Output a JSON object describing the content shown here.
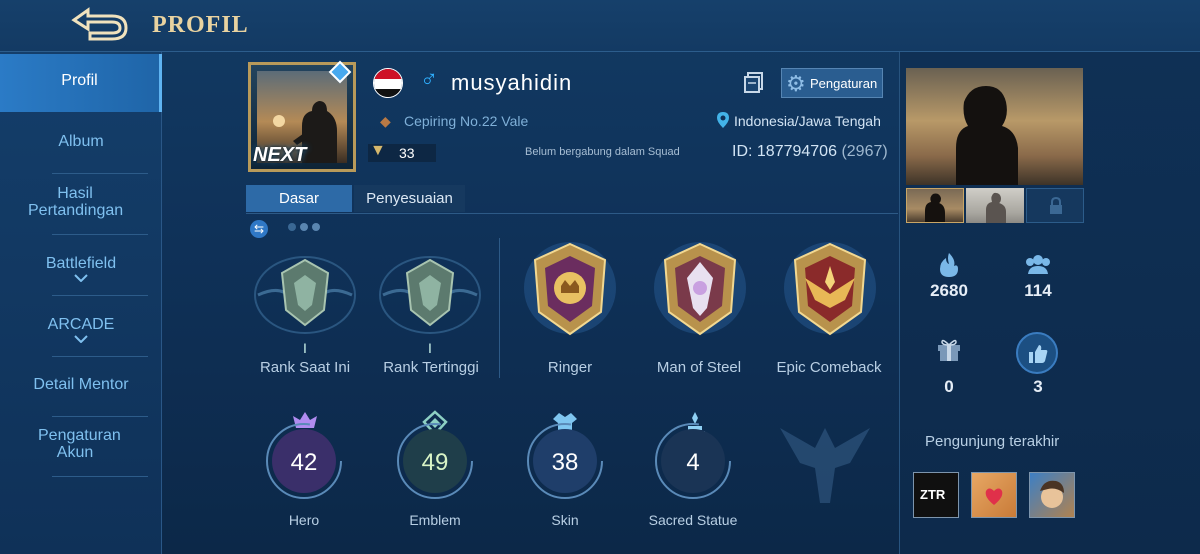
{
  "header": {
    "title": "PROFIL"
  },
  "sidebar": {
    "items": [
      {
        "label": "Profil"
      },
      {
        "label": "Album"
      },
      {
        "label": "Hasil Pertandingan"
      },
      {
        "label": "Battlefield"
      },
      {
        "label": "ARCADE"
      },
      {
        "label": "Detail Mentor"
      },
      {
        "label": "Pengaturan Akun"
      }
    ]
  },
  "profile": {
    "username": "musyahidin",
    "gender_icon": "male-icon",
    "guild": "Cepiring No.22 Vale",
    "level": "33",
    "squad_status": "Belum bergabung dalam Squad",
    "location": "Indonesia/Jawa Tengah",
    "id_label": "ID: 187794706",
    "server": "(2967)",
    "settings_label": "Pengaturan",
    "avatar_frame_text": "NEXT"
  },
  "tabs": [
    {
      "label": "Dasar"
    },
    {
      "label": "Penyesuaian"
    }
  ],
  "badges": [
    {
      "label": "Rank Saat Ini",
      "tier": "I"
    },
    {
      "label": "Rank Tertinggi",
      "tier": "I"
    },
    {
      "label": "Ringer"
    },
    {
      "label": "Man of Steel"
    },
    {
      "label": "Epic Comeback"
    }
  ],
  "stats": [
    {
      "label": "Hero",
      "value": "42"
    },
    {
      "label": "Emblem",
      "value": "49"
    },
    {
      "label": "Skin",
      "value": "38"
    },
    {
      "label": "Sacred Statue",
      "value": "4"
    }
  ],
  "side_stats": {
    "popularity": "2680",
    "followers": "114",
    "gifts": "0",
    "likes": "3"
  },
  "visitors": {
    "label": "Pengunjung terakhir",
    "first_tag": "ZTR"
  },
  "colors": {
    "accent": "#2d6aa7",
    "gold": "#e9d3a0",
    "text_blue": "#7fc0ef"
  }
}
